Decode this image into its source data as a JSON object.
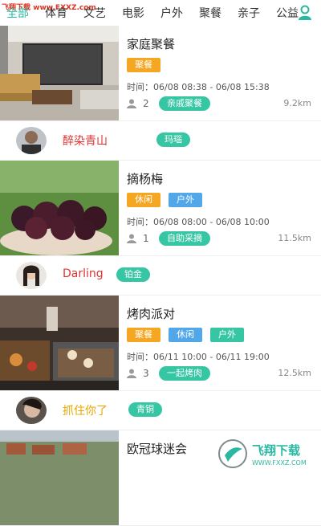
{
  "watermark_top": "飞翔下载 www.FXXZ.com",
  "tabs": [
    "全部",
    "体育",
    "文艺",
    "电影",
    "户外",
    "聚餐",
    "亲子",
    "公益"
  ],
  "active_tab": 0,
  "cards": [
    {
      "title": "家庭聚餐",
      "tags": [
        {
          "label": "聚餐",
          "color": "orange"
        }
      ],
      "time": "时间：06/08 08:38 - 06/08 15:38",
      "count": "2",
      "group": "亲戚聚餐",
      "distance": "9.2km"
    },
    {
      "title": "摘杨梅",
      "tags": [
        {
          "label": "休闲",
          "color": "orange"
        },
        {
          "label": "户外",
          "color": "blue"
        }
      ],
      "time": "时间：06/08 08:00 - 06/08 10:00",
      "count": "1",
      "group": "自助采摘",
      "distance": "11.5km"
    },
    {
      "title": "烤肉派对",
      "tags": [
        {
          "label": "聚餐",
          "color": "orange"
        },
        {
          "label": "休闲",
          "color": "blue"
        },
        {
          "label": "户外",
          "color": "teal"
        }
      ],
      "time": "时间：06/11 10:00 - 06/11 19:00",
      "count": "3",
      "group": "一起烤肉",
      "distance": "12.5km"
    },
    {
      "title": "欧冠球迷会"
    }
  ],
  "users": [
    {
      "name": "醉染青山",
      "level": "玛瑙",
      "color": "#d33"
    },
    {
      "name": "Darling",
      "level": "铂金",
      "color": "#d33"
    },
    {
      "name": "抓住你了",
      "level": "青铜",
      "color": "#e6a700"
    }
  ],
  "brand_logo": {
    "name": "飞翔下载",
    "url": "WWW.FXXZ.COM"
  }
}
